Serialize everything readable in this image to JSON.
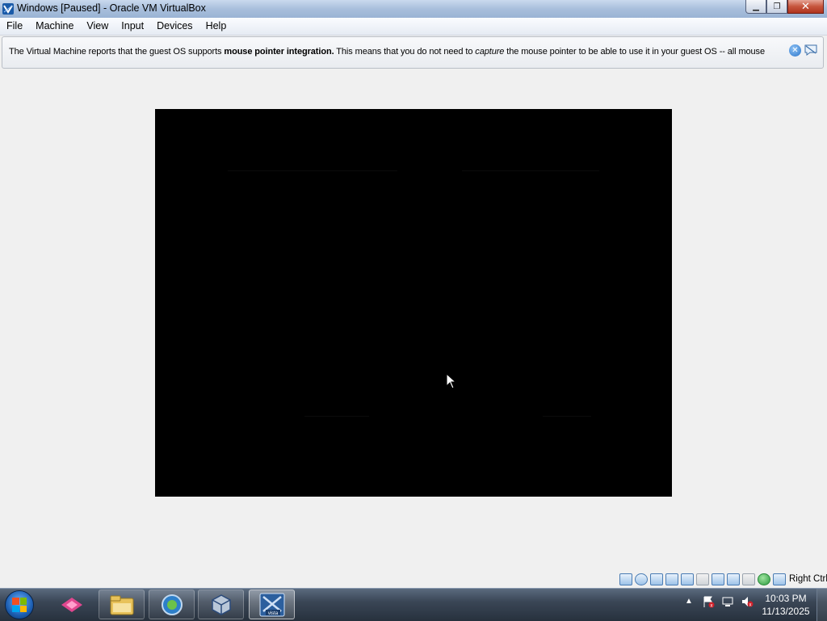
{
  "window": {
    "title": "Windows [Paused] - Oracle VM VirtualBox",
    "minimize_glyph": "▁",
    "maximize_glyph": "❐",
    "close_glyph": "✕"
  },
  "menu": [
    "File",
    "Machine",
    "View",
    "Input",
    "Devices",
    "Help"
  ],
  "banner": {
    "part1": "The Virtual Machine reports that the guest OS supports ",
    "bold": "mouse pointer integration.",
    "part2": " This means that you do not need to ",
    "italic": "capture",
    "part3": " the mouse pointer to be able to use it in your guest OS -- all mouse",
    "close_glyph": "✕"
  },
  "statusbar": {
    "host_key": "Right Ctrl",
    "icons": [
      "hard-disk-icon",
      "optical-drive-icon",
      "audio-icon",
      "network-icon",
      "usb-icon",
      "shared-folders-icon",
      "display-icon",
      "video-capture-icon",
      "vrde-icon",
      "mouse-integration-icon",
      "network-activity-icon",
      "host-key-icon"
    ]
  },
  "taskbar": {
    "pinned": [
      "photo-app-icon",
      "file-explorer-icon",
      "media-app-icon",
      "virtualbox-icon",
      "vista-vm-icon"
    ],
    "vm_label": "vista",
    "tray_arrow": "▲",
    "time": "10:03 PM",
    "date": "11/13/2025"
  },
  "colors": {
    "vm_background": "#000000",
    "window_background": "#f0f0f0",
    "taskbar": "#3a4656"
  }
}
